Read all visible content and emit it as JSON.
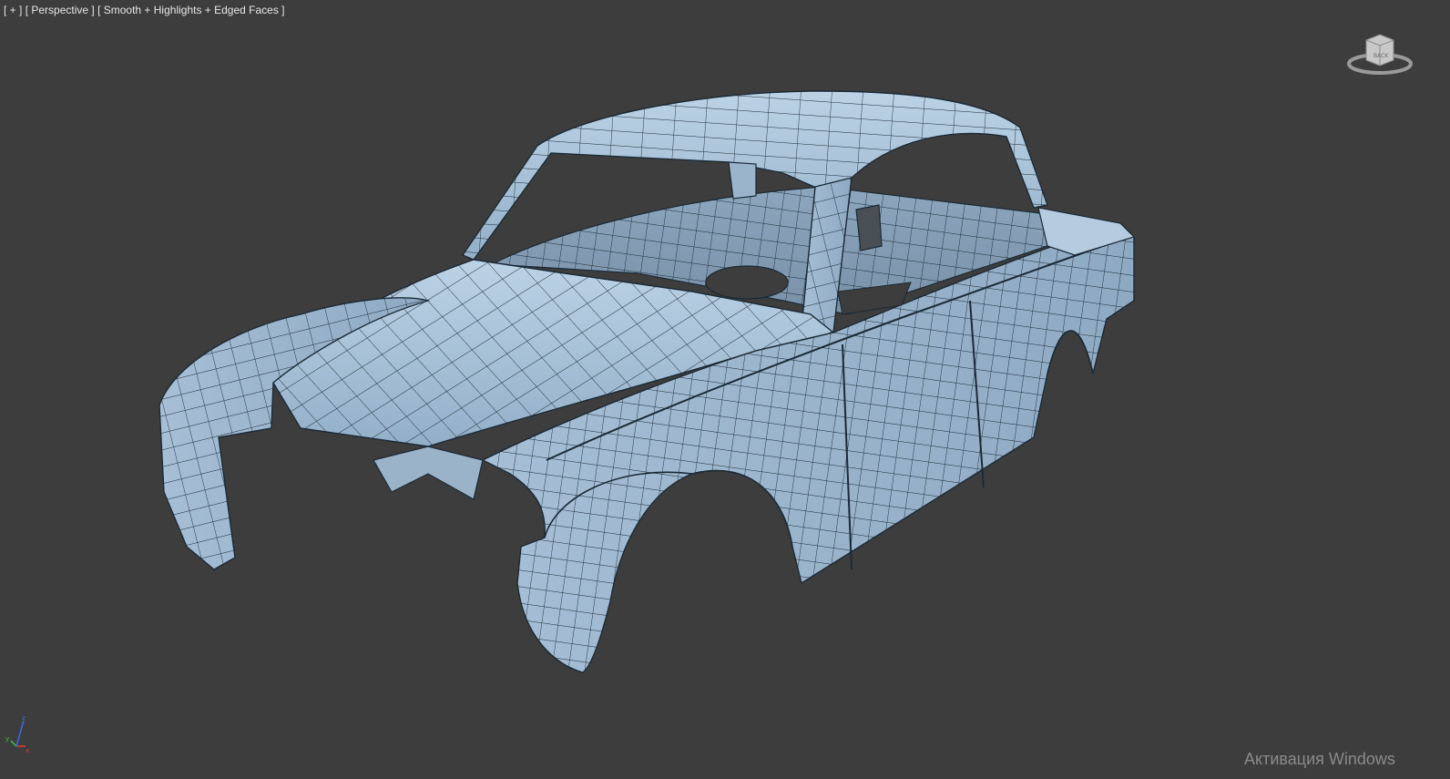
{
  "viewport": {
    "menu_plus": "[ + ]",
    "view_name": "[ Perspective ]",
    "shading_mode": "[ Smooth + Highlights + Edged Faces ]"
  },
  "viewcube": {
    "face_label": "BACK",
    "icon": "viewcube-icon"
  },
  "axis": {
    "x_label": "x",
    "y_label": "y",
    "z_label": "z",
    "x_color": "#e03a2a",
    "y_color": "#3cc43c",
    "z_color": "#3a6ae8"
  },
  "model": {
    "description_icon": "car-body-mesh",
    "surface_color": "#a9c3d9",
    "edge_color": "#1b2a36",
    "background_color": "#3d3d3d"
  },
  "watermark": {
    "text": "Активация Windows"
  }
}
